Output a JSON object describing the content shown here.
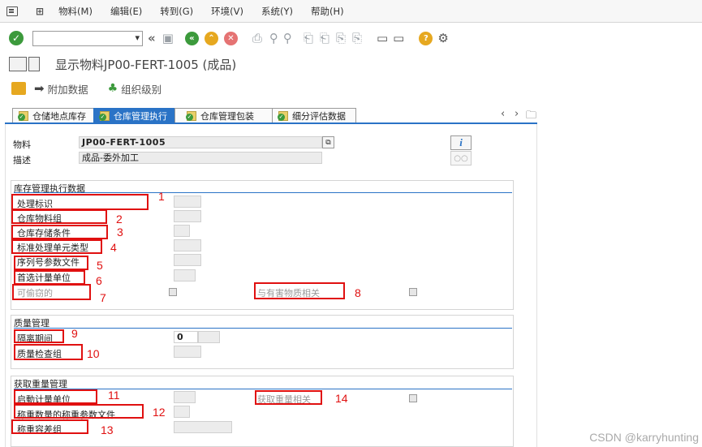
{
  "menu": {
    "items": [
      "物料(M)",
      "编辑(E)",
      "转到(G)",
      "环境(V)",
      "系统(Y)",
      "帮助(H)"
    ]
  },
  "toolbar": {
    "command_value": ""
  },
  "title": {
    "text": "显示物料JP00-FERT-1005 (成品)"
  },
  "app_toolbar": {
    "additional_data": "附加数据",
    "org_levels": "组织级别"
  },
  "tabs": [
    {
      "label": "仓储地点库存",
      "active": false
    },
    {
      "label": "仓库管理执行",
      "active": true
    },
    {
      "label": "仓库管理包装",
      "active": false
    },
    {
      "label": "细分评估数据",
      "active": false
    }
  ],
  "header_fields": {
    "material_label": "物料",
    "material_value": "JP00-FERT-1005",
    "desc_label": "描述",
    "desc_value": "成品-委外加工"
  },
  "group_wm": {
    "title": "库存管理执行数据",
    "fields": [
      {
        "label": "处理标识",
        "num": "1"
      },
      {
        "label": "仓库物料组",
        "num": "2"
      },
      {
        "label": "仓库存储条件",
        "num": "3"
      },
      {
        "label": "标准处理单元类型",
        "num": "4"
      },
      {
        "label": "序列号参数文件",
        "num": "5"
      },
      {
        "label": "首选计量单位",
        "num": "6"
      }
    ],
    "pilferable_label": "可偷窃的",
    "pilferable_num": "7",
    "hazardous_label": "与有害物质相关",
    "hazardous_num": "8"
  },
  "group_qm": {
    "title": "质量管理",
    "quarantine_label": "隔离期间",
    "quarantine_value": "0",
    "quarantine_num": "9",
    "inspection_group_label": "质量检查组",
    "inspection_group_num": "10"
  },
  "group_cw": {
    "title": "获取重量管理",
    "log_uom_label": "启動计量单位",
    "log_uom_num": "11",
    "cw_relevant_label": "获取重量相关",
    "cw_relevant_num": "14",
    "cw_profile_label": "称重数量的称重参数文件",
    "cw_profile_num": "12",
    "cw_tolerance_label": "称重容差组",
    "cw_tolerance_num": "13"
  },
  "watermark": "CSDN @karryhunting"
}
